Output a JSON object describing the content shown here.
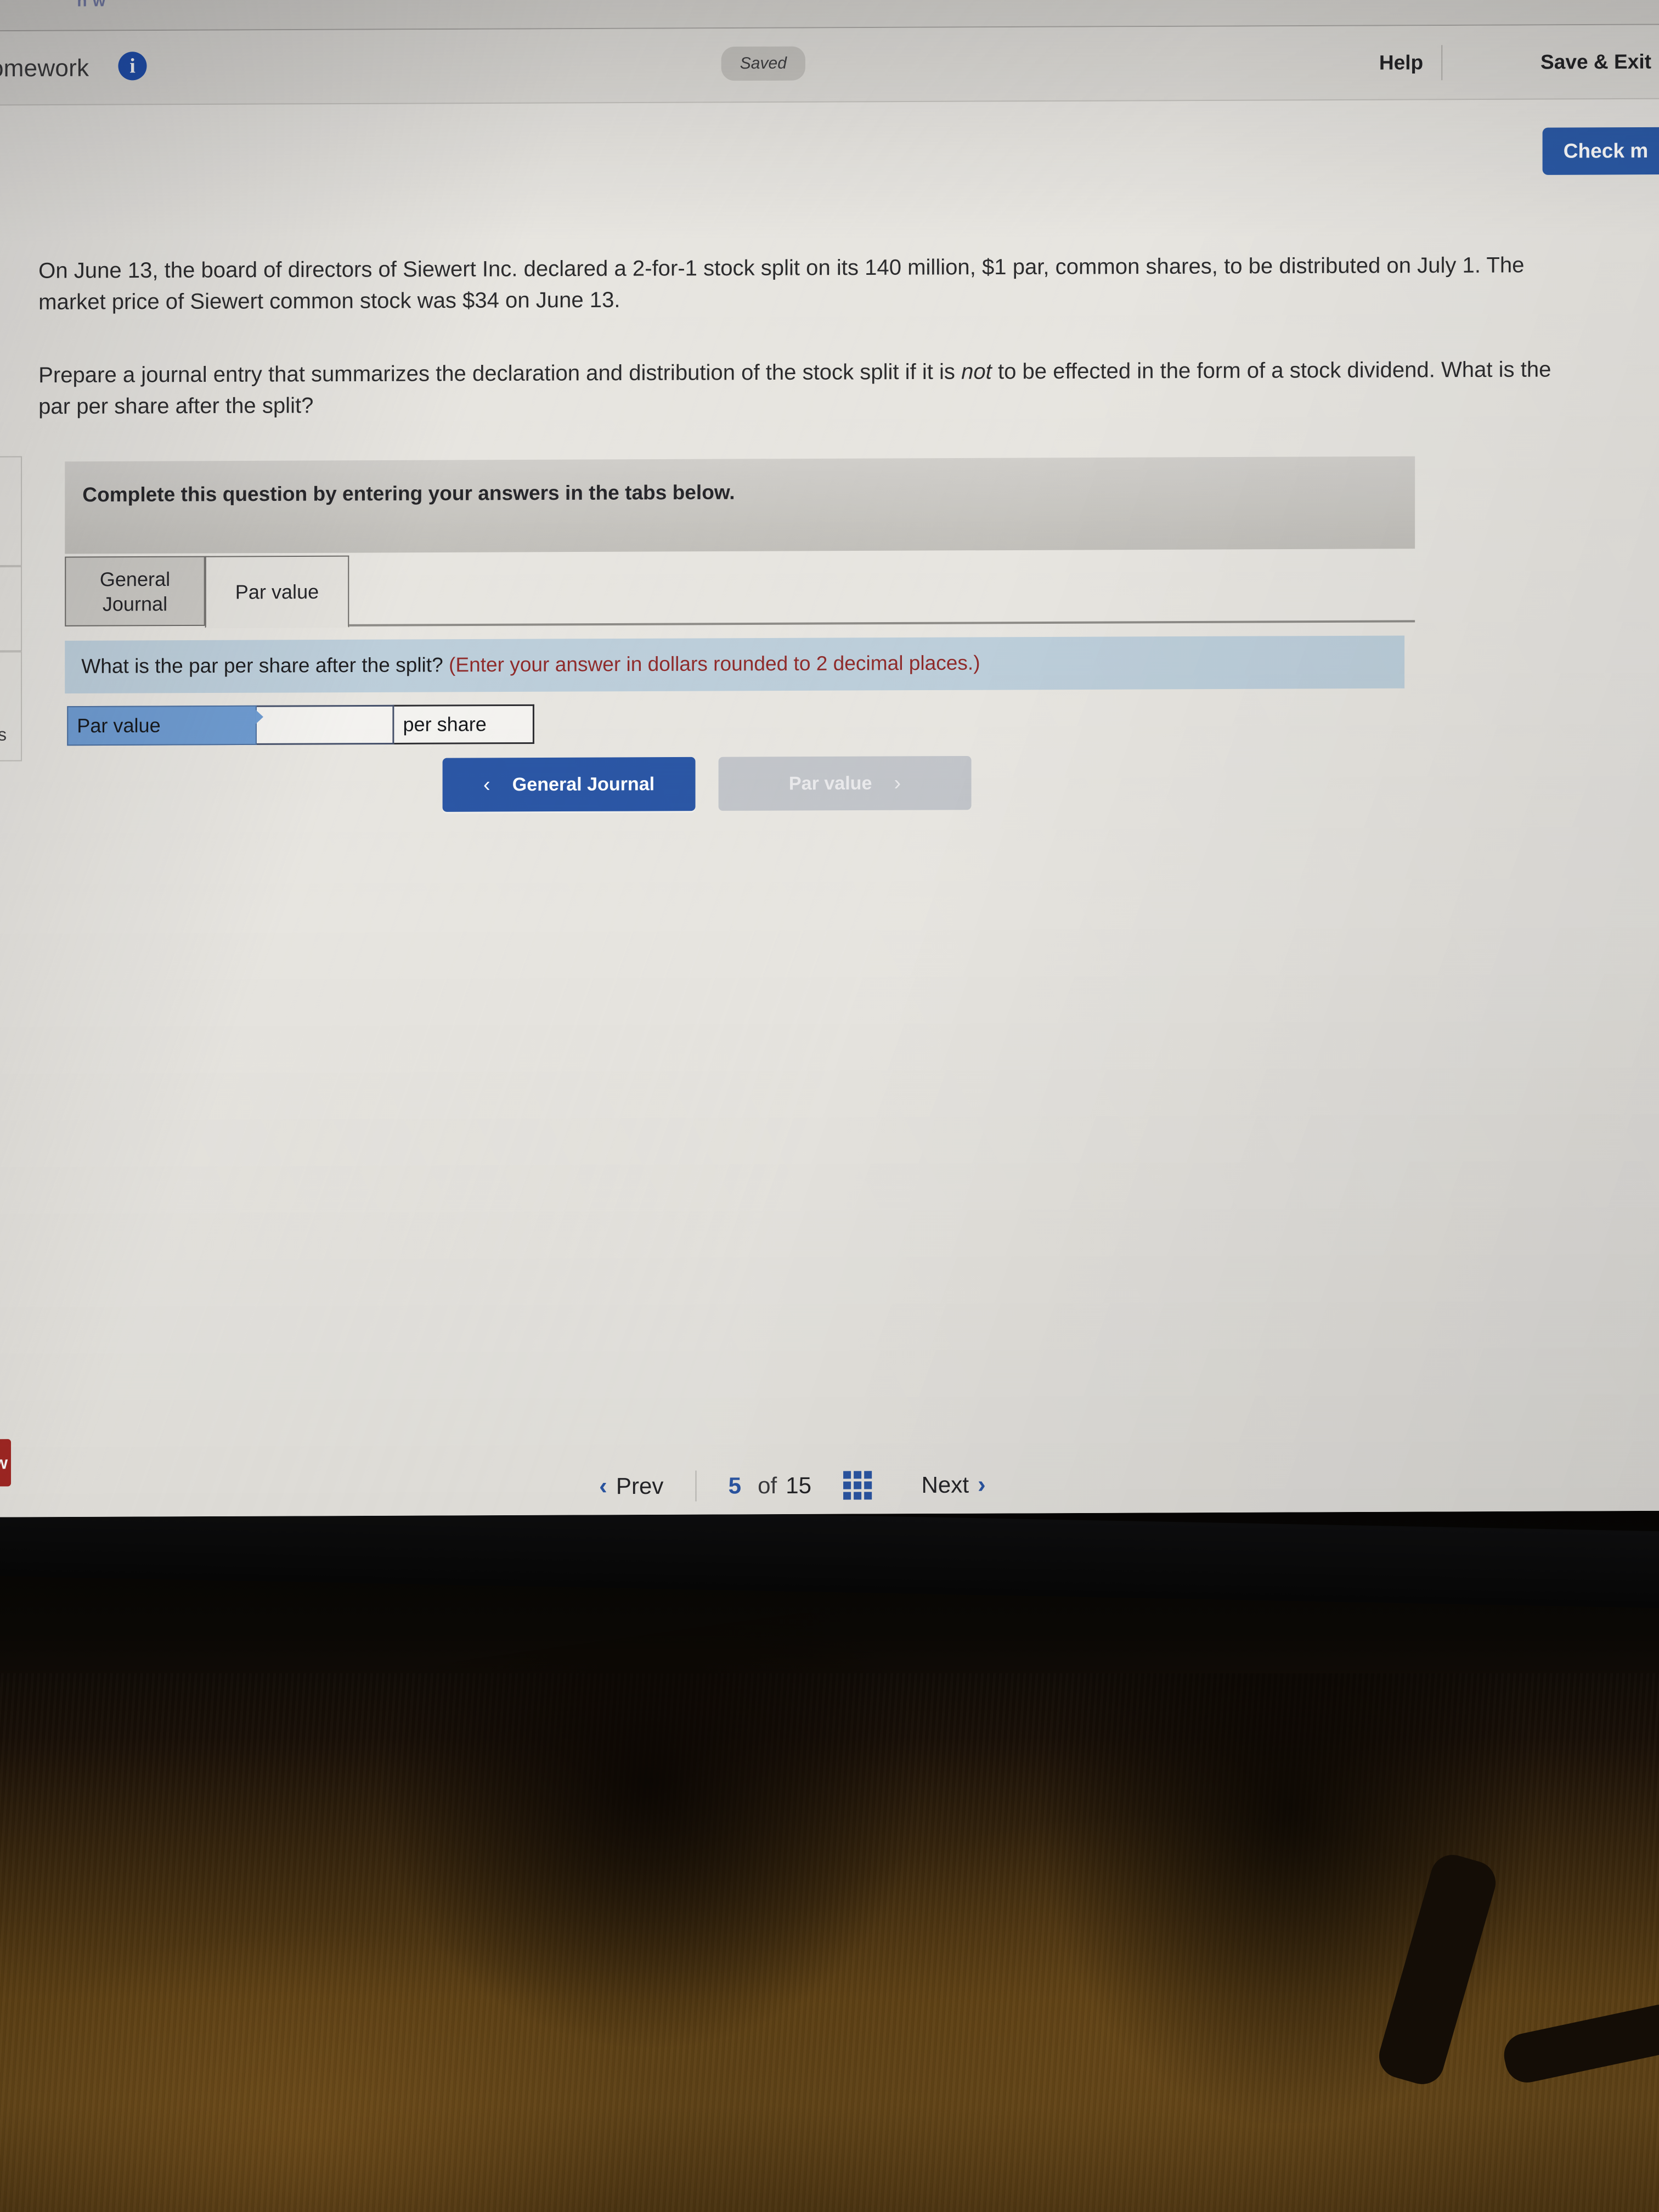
{
  "header": {
    "top_sliver": "h w",
    "title": "omework",
    "info_icon": "i",
    "saved_badge": "Saved",
    "help_label": "Help",
    "save_exit_label": "Save & Exit",
    "check_my_work_label": "Check m"
  },
  "question": {
    "paragraph_1": "On June 13, the board of directors of Siewert Inc. declared a 2-for-1 stock split on its 140 million, $1 par, common shares, to be distributed on July 1. The market price of Siewert common stock was $34 on June 13.",
    "paragraph_2_a": "Prepare a journal entry that summarizes the declaration and distribution of the stock split if it is ",
    "paragraph_2_em": "not",
    "paragraph_2_b": " to be effected in the form of a stock dividend. What is the par per share after the split?"
  },
  "banner": {
    "complete_text": "Complete this question by entering your answers in the tabs below."
  },
  "tabs": [
    {
      "label": "General\nJournal",
      "line1": "General",
      "line2": "Journal",
      "active": false
    },
    {
      "label": "Par value",
      "line1": "Par value",
      "line2": "",
      "active": true
    }
  ],
  "instruction": {
    "prompt": "What is the par per share after the split?",
    "note": "(Enter your answer in dollars rounded to 2 decimal places.)"
  },
  "answer_row": {
    "label": "Par value",
    "value": "",
    "placeholder": "",
    "suffix": "per share"
  },
  "tab_nav": {
    "prev_chevron": "‹",
    "prev_label": "General Journal",
    "next_label": "Par value",
    "next_chevron": "›"
  },
  "pager": {
    "prev_chevron": "‹",
    "prev_label": "Prev",
    "current": "5",
    "of_label": "of",
    "total": "15",
    "grid_icon": "grid-icon",
    "next_label": "Next",
    "next_chevron": "›"
  },
  "edge": {
    "partial_letter": "s",
    "red_tab_label": "w"
  },
  "colors": {
    "primary_blue": "#2a56a5",
    "band_blue": "#bdcfdb",
    "label_blue": "#6e9bd1",
    "note_red": "#8f2a2a",
    "red_tab": "#a32622",
    "page_bg": "#e8e6e1"
  }
}
